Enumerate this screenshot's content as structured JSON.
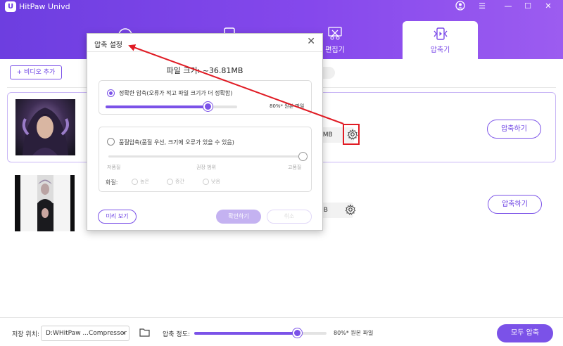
{
  "app": {
    "title": "HitPaw Univd"
  },
  "tabs": {
    "editor": "편집기",
    "compressor": "압축기"
  },
  "toolbar": {
    "add_video": "+ 비디오 추가"
  },
  "files": [
    {
      "size": "1MB",
      "compress_label": "압축하기"
    },
    {
      "size": "MB",
      "compress_label": "압축하기"
    }
  ],
  "footer": {
    "save_label": "저장 위치:",
    "save_path": "D:WHitPaw ...Compressor",
    "level_label": "압축 정도:",
    "level_text": "80%* 원본 파일",
    "level_value": 0.78,
    "compress_all": "모두 압축"
  },
  "dialog": {
    "title": "압축 설정",
    "file_size": "파일 크기: ~36.81MB",
    "exact_label": "정확한 압축(오류가 적고 파일 크기가 더 정확함)",
    "exact_level_text": "80%* 원본 파일",
    "exact_level": 0.78,
    "quality_label": "품질압축(품질 우선, 크기에 오류가 있을 수 있음)",
    "quality_low": "저품질",
    "quality_mid": "권장 범위",
    "quality_high": "고품질",
    "quality_level": 1.0,
    "resolution_label": "화질:",
    "resolution_options": [
      "높은",
      "중간",
      "낮음"
    ],
    "preview_button": "미리 보기",
    "confirm_button": "확인하기",
    "cancel_button": "취소"
  },
  "colors": {
    "accent": "#7b52e8",
    "header": "#7b45ea",
    "annotation": "#e01b24"
  },
  "icons": {
    "logo": "hitpaw-logo",
    "settings": "gear-icon",
    "folder": "folder-icon",
    "user": "user-icon"
  }
}
